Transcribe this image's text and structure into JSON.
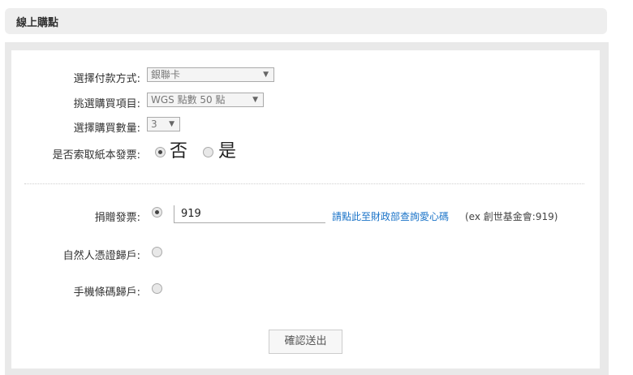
{
  "header": {
    "title": "線上購點"
  },
  "form": {
    "payment_method": {
      "label": "選擇付款方式:",
      "value": "銀聯卡"
    },
    "item": {
      "label": "挑選購買項目:",
      "value": "WGS 點數 50 點"
    },
    "quantity": {
      "label": "選擇購買數量:",
      "value": "3"
    },
    "paper_invoice": {
      "label": "是否索取紙本發票:",
      "option_no": "否",
      "option_yes": "是",
      "selected": "否"
    },
    "donate_invoice": {
      "label": "捐贈發票:",
      "code_value": "919",
      "lookup_link": "請點此至財政部查詢愛心碼",
      "hint": "(ex 創世基金會:919)"
    },
    "natural_person_carrier": {
      "label": "自然人憑證歸戶:"
    },
    "mobile_barcode_carrier": {
      "label": "手機條碼歸戶:"
    },
    "submit_label": "確認送出"
  }
}
